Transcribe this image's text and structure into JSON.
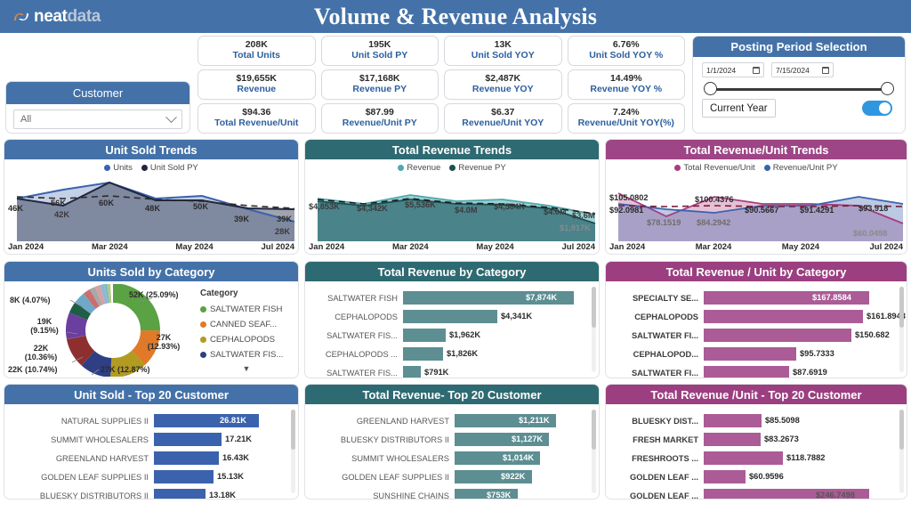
{
  "header": {
    "brand_primary": "neat",
    "brand_secondary": "data",
    "title": "Volume & Revenue Analysis",
    "bg": "#4472a8"
  },
  "kpis": [
    {
      "value": "208K",
      "label": "Total Units"
    },
    {
      "value": "195K",
      "label": "Unit Sold PY"
    },
    {
      "value": "13K",
      "label": "Unit Sold YOY"
    },
    {
      "value": "6.76%",
      "label": "Unit Sold YOY %"
    },
    {
      "value": "$19,655K",
      "label": "Revenue"
    },
    {
      "value": "$17,168K",
      "label": "Revenue PY"
    },
    {
      "value": "$2,487K",
      "label": "Revenue YOY"
    },
    {
      "value": "14.49%",
      "label": "Revenue YOY %"
    },
    {
      "value": "$94.36",
      "label": "Total Revenue/Unit"
    },
    {
      "value": "$87.99",
      "label": "Revenue/Unit PY"
    },
    {
      "value": "$6.37",
      "label": "Revenue/Unit YOY"
    },
    {
      "value": "7.24%",
      "label": "Revenue/Unit YOY(%)"
    }
  ],
  "customer_slicer": {
    "title": "Customer",
    "selected": "All"
  },
  "posting_period": {
    "title": "Posting Period Selection",
    "start_date": "1/1/2024",
    "end_date": "7/15/2024",
    "mode_label": "Current Year",
    "toggle_on": true
  },
  "chart_data": [
    {
      "id": "unit-sold-trends",
      "type": "area",
      "title": "Unit Sold Trends",
      "x": [
        "Jan 2024",
        "Feb 2024",
        "Mar 2024",
        "Apr 2024",
        "May 2024",
        "Jun 2024",
        "Jul 2024"
      ],
      "tick_labels": [
        "Jan 2024",
        "Mar 2024",
        "May 2024",
        "Jul 2024"
      ],
      "series": [
        {
          "name": "Units",
          "color": "#3b63ad",
          "values": [
            46000,
            56000,
            60000,
            48000,
            50000,
            39000,
            28000
          ]
        },
        {
          "name": "Unit Sold PY",
          "color": "#20263f",
          "values": [
            46000,
            42000,
            60000,
            47000,
            47000,
            40000,
            39000
          ]
        }
      ],
      "data_labels": [
        "46K",
        "56K",
        "60K",
        "48K",
        "50K",
        "39K",
        "39K"
      ],
      "extra_labels": [
        "42K",
        "28K"
      ],
      "legend_position": "top"
    },
    {
      "id": "total-revenue-trends",
      "type": "area",
      "title": "Total Revenue Trends",
      "x": [
        "Jan 2024",
        "Feb 2024",
        "Mar 2024",
        "Apr 2024",
        "May 2024",
        "Jun 2024",
        "Jul 2024"
      ],
      "tick_labels": [
        "Jan 2024",
        "Mar 2024",
        "May 2024",
        "Jul 2024"
      ],
      "series": [
        {
          "name": "Revenue",
          "color": "#4fa9ad",
          "values": [
            4853000,
            4342000,
            5536000,
            4000000,
            4584000,
            4000000,
            3600000
          ]
        },
        {
          "name": "Revenue PY",
          "color": "#1d4f52",
          "values": [
            4700000,
            4250000,
            4900000,
            4300000,
            4300000,
            3900000,
            1917000
          ]
        }
      ],
      "data_labels": [
        "$4,853K",
        "$4,342K",
        "$5,536K",
        "$4.0M",
        "$4,584K",
        "$4.0M",
        "$3.6M"
      ],
      "extra_labels": [
        "$1,917K"
      ],
      "legend_position": "top"
    },
    {
      "id": "total-revenue-unit-trends",
      "type": "area",
      "title": "Total Revenue/Unit Trends",
      "x": [
        "Jan 2024",
        "Feb 2024",
        "Mar 2024",
        "Apr 2024",
        "May 2024",
        "Jun 2024",
        "Jul 2024"
      ],
      "tick_labels": [
        "Jan 2024",
        "Mar 2024",
        "May 2024",
        "Jul 2024"
      ],
      "series": [
        {
          "name": "Total Revenue/Unit",
          "color": "#a83d7e",
          "values": [
            105.0802,
            78.1519,
            100.4376,
            90.5667,
            91.4291,
            88.0,
            60.0498
          ]
        },
        {
          "name": "Revenue/Unit PY",
          "color": "#3b63ad",
          "values": [
            92.0981,
            85.0,
            84.2942,
            90.0,
            90.5,
            96.5,
            93.918
          ]
        }
      ],
      "data_labels": [
        "$105.0802",
        "$78.1519",
        "$100.4376",
        "$90.5667",
        "$91.4291",
        "",
        "$93.918"
      ],
      "extra_labels": [
        "$92.0981",
        "$84.2942",
        "$60.0498"
      ],
      "legend_position": "top"
    },
    {
      "id": "units-sold-by-category",
      "type": "pie",
      "title": "Units Sold by Category",
      "legend_title": "Category",
      "legend_position": "right",
      "slices": [
        {
          "label": "52K (25.09%)",
          "value": 25.09,
          "color": "#5aa244",
          "legend": "SALTWATER FISH"
        },
        {
          "label": "27K (12.93%)",
          "value": 12.93,
          "color": "#e07a28",
          "legend": "CANNED SEAF..."
        },
        {
          "label": "27K (12.87%)",
          "value": 12.87,
          "color": "#b39b22",
          "legend": "CEPHALOPODS"
        },
        {
          "label": "22K (10.74%)",
          "value": 10.74,
          "color": "#2e3f84",
          "legend": "SALTWATER FIS..."
        },
        {
          "label": "22K (10.36%)",
          "value": 10.36,
          "color": "#8e2f2f",
          "legend": ""
        },
        {
          "label": "19K (9.15%)",
          "value": 9.15,
          "color": "#6a3fa0",
          "legend": ""
        },
        {
          "label": "8K (4.07%)",
          "value": 4.07,
          "color": "#1f5e46",
          "legend": ""
        },
        {
          "label": "",
          "value": 4.0,
          "color": "#6fa8c9",
          "legend": ""
        },
        {
          "label": "",
          "value": 2.6,
          "color": "#c96f6f",
          "legend": ""
        },
        {
          "label": "",
          "value": 2.0,
          "color": "#a8a8a8",
          "legend": ""
        },
        {
          "label": "",
          "value": 1.7,
          "color": "#d9a0a0",
          "legend": ""
        },
        {
          "label": "",
          "value": 1.4,
          "color": "#8fb5d6",
          "legend": ""
        },
        {
          "label": "",
          "value": 1.2,
          "color": "#7fbfbf",
          "legend": ""
        },
        {
          "label": "",
          "value": 1.0,
          "color": "#b7c97f",
          "legend": ""
        }
      ]
    },
    {
      "id": "total-revenue-by-category",
      "type": "bar",
      "title": "Total Revenue by Category",
      "orientation": "horizontal",
      "bar_color": "#5c8e92",
      "categories": [
        "SALTWATER FISH",
        "CEPHALOPODS",
        "SALTWATER FIS...",
        "CEPHALOPODS ...",
        "SALTWATER FIS..."
      ],
      "values": [
        7874,
        4341,
        1962,
        1826,
        791
      ],
      "value_labels": [
        "$7,874K",
        "$4,341K",
        "$1,962K",
        "$1,826K",
        "$791K"
      ]
    },
    {
      "id": "total-revenue-unit-by-category",
      "type": "bar",
      "title": "Total Revenue / Unit by Category",
      "orientation": "horizontal",
      "bar_color": "#ab5c96",
      "categories": [
        "SPECIALTY SE...",
        "CEPHALOPODS",
        "SALTWATER FI...",
        "CEPHALOPOD...",
        "SALTWATER FI..."
      ],
      "values": [
        167.8584,
        161.8943,
        150.682,
        95.7333,
        87.6919
      ],
      "value_labels": [
        "$167.8584",
        "$161.8943",
        "$150.682",
        "$95.7333",
        "$87.6919"
      ]
    },
    {
      "id": "unit-sold-top-20-customer",
      "type": "bar",
      "title": "Unit Sold - Top 20 Customer",
      "orientation": "horizontal",
      "bar_color": "#3b63ad",
      "categories": [
        "NATURAL SUPPLIES II",
        "SUMMIT WHOLESALERS",
        "GREENLAND HARVEST",
        "GOLDEN LEAF SUPPLIES II",
        "BLUESKY DISTRIBUTORS II"
      ],
      "values": [
        26.81,
        17.21,
        16.43,
        15.13,
        13.18
      ],
      "value_labels": [
        "26.81K",
        "17.21K",
        "16.43K",
        "15.13K",
        "13.18K"
      ]
    },
    {
      "id": "total-revenue-top-20-customer",
      "type": "bar",
      "title": "Total Revenue- Top 20 Customer",
      "orientation": "horizontal",
      "bar_color": "#5c8e92",
      "categories": [
        "GREENLAND HARVEST",
        "BLUESKY DISTRIBUTORS II",
        "SUMMIT WHOLESALERS",
        "GOLDEN LEAF SUPPLIES II",
        "SUNSHINE CHAINS"
      ],
      "values": [
        1211,
        1127,
        1014,
        922,
        753
      ],
      "value_labels": [
        "$1,211K",
        "$1,127K",
        "$1,014K",
        "$922K",
        "$753K"
      ]
    },
    {
      "id": "total-revenue-unit-top-20-customer",
      "type": "bar",
      "title": "Total Revenue /Unit - Top 20 Customer",
      "orientation": "horizontal",
      "bar_color": "#ab5c96",
      "categories": [
        "BLUESKY DIST...",
        "FRESH MARKET",
        "FRESHROOTS ...",
        "GOLDEN LEAF ...",
        "GOLDEN LEAF ..."
      ],
      "values": [
        85.5098,
        83.2673,
        118.7882,
        60.9596,
        246.7498
      ],
      "value_labels": [
        "$85.5098",
        "$83.2673",
        "$118.7882",
        "$60.9596",
        "$246.7498"
      ]
    }
  ]
}
